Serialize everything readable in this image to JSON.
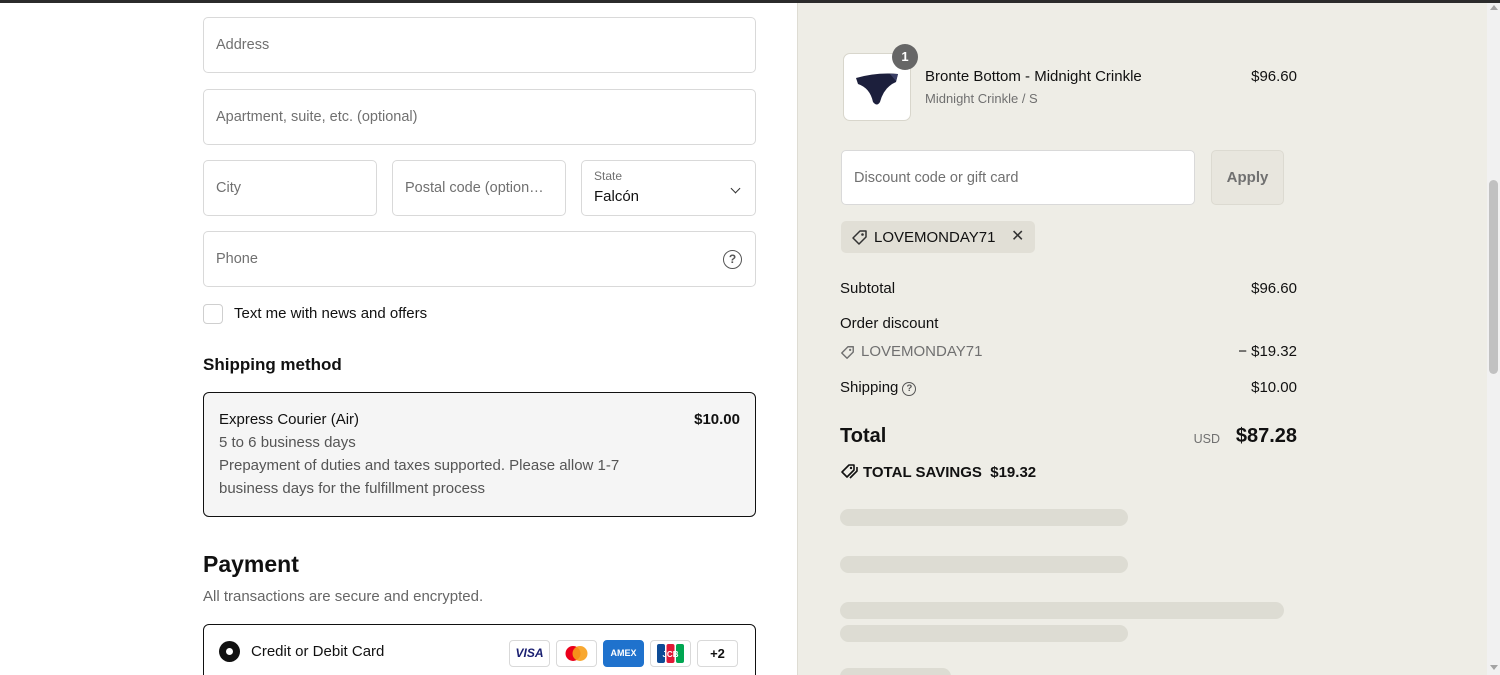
{
  "address_form": {
    "address_placeholder": "Address",
    "apartment_placeholder": "Apartment, suite, etc. (optional)",
    "city_placeholder": "City",
    "postal_placeholder": "Postal code (option…",
    "state_label": "State",
    "state_value": "Falcón",
    "phone_placeholder": "Phone",
    "sms_optin_label": "Text me with news and offers"
  },
  "shipping": {
    "heading": "Shipping method",
    "option_name": "Express Courier (Air)",
    "option_price": "$10.00",
    "option_eta": "5 to 6 business days",
    "option_note_line1": "Prepayment of duties and taxes supported. Please allow 1-7",
    "option_note_line2": "business days for the fulfillment process"
  },
  "payment": {
    "heading": "Payment",
    "subtitle": "All transactions are secure and encrypted.",
    "method_label": "Credit or Debit Card",
    "card_brands": [
      "VISA",
      "mastercard",
      "AMEX",
      "JCB"
    ],
    "more_brands": "+2"
  },
  "order_summary": {
    "product": {
      "quantity": "1",
      "name": "Bronte Bottom - Midnight Crinkle",
      "variant": "Midnight Crinkle / S",
      "price": "$96.60"
    },
    "discount_placeholder": "Discount code or gift card",
    "apply_label": "Apply",
    "applied_code": "LOVEMONDAY71",
    "subtotal_label": "Subtotal",
    "subtotal_value": "$96.60",
    "order_discount_label": "Order discount",
    "discount_code": "LOVEMONDAY71",
    "discount_value": "− $19.32",
    "shipping_label": "Shipping",
    "shipping_value": "$10.00",
    "total_label": "Total",
    "currency": "USD",
    "total_value": "$87.28",
    "savings_label": "TOTAL SAVINGS",
    "savings_value": "$19.32"
  },
  "colors": {
    "summary_background": "#eeede6",
    "primary_text": "#111111",
    "muted_text": "#707070"
  }
}
